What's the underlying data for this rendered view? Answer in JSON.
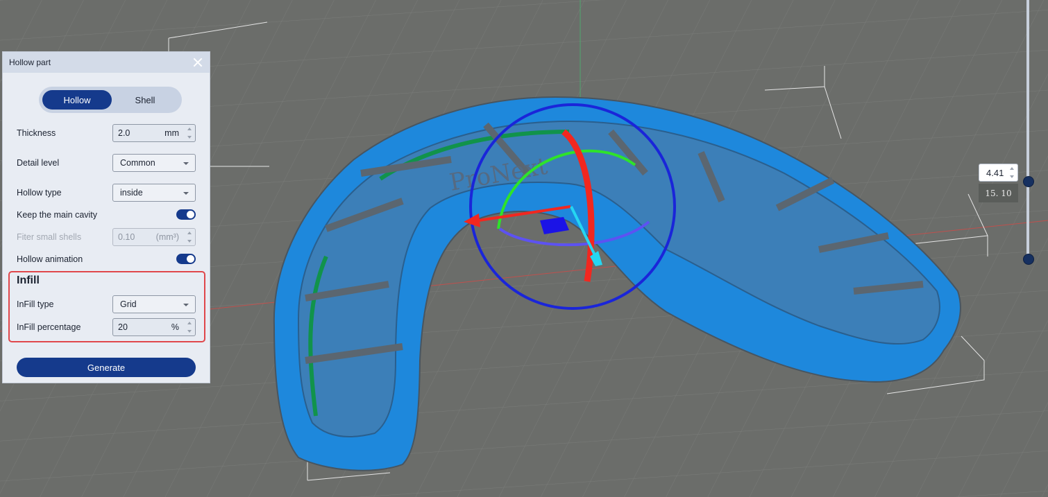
{
  "panel": {
    "title": "Hollow part",
    "tabs": [
      "Hollow",
      "Shell"
    ],
    "fields": {
      "thickness": {
        "label": "Thickness",
        "value": "2.0",
        "unit": "mm"
      },
      "detail_level": {
        "label": "Detail level",
        "value": "Common"
      },
      "hollow_type": {
        "label": "Hollow type",
        "value": "inside"
      },
      "keep_main_cavity": {
        "label": "Keep the main cavity",
        "on": true
      },
      "filter_small_shells": {
        "label": "Fiter small shells",
        "value": "0.10",
        "unit": "(mm³)"
      },
      "hollow_animation": {
        "label": "Hollow animation",
        "on": true
      }
    },
    "infill": {
      "title": "Infill",
      "type_label": "InFill type",
      "type_value": "Grid",
      "pct_label": "InFill percentage",
      "pct_value": "20",
      "pct_unit": "%"
    },
    "generate_label": "Generate"
  },
  "viewport": {
    "model_label": "ProNext",
    "layer_slider": {
      "current": "4.41",
      "max": "15. 10"
    }
  },
  "colors": {
    "accent": "#153a8c",
    "model": "#1e88dc",
    "highlight": "#e0464a"
  }
}
